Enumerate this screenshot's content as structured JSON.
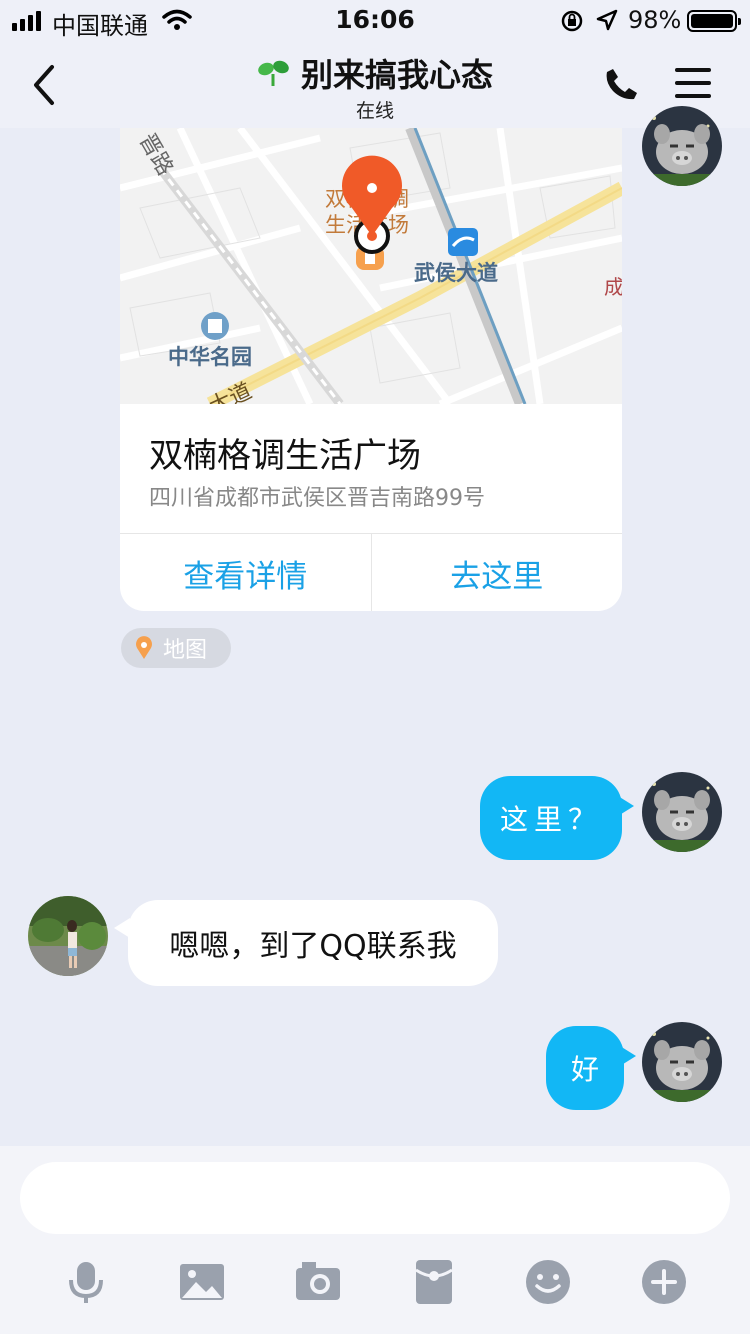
{
  "status_bar": {
    "carrier": "中国联通",
    "time": "16:06",
    "battery": "98%"
  },
  "header": {
    "title": "别来搞我心态",
    "subtitle": "在线"
  },
  "map_card": {
    "map_labels": {
      "road_1": "晋路",
      "poi_top": "双楠格调",
      "poi_bottom": "生活广场",
      "avenue": "武侯大道",
      "garden": "中华名园",
      "road_2": "大道",
      "edge_text": "成"
    },
    "place_name": "双楠格调生活广场",
    "address": "四川省成都市武侯区晋吉南路99号",
    "btn_details": "查看详情",
    "btn_go": "去这里"
  },
  "map_tag": "地图",
  "messages": [
    {
      "direction": "out",
      "text": "这里？"
    },
    {
      "direction": "in",
      "text": "嗯嗯，到了QQ联系我"
    },
    {
      "direction": "out",
      "text": "好"
    }
  ],
  "input": {
    "placeholder": ""
  },
  "toolbar_icons": [
    "mic-icon",
    "image-icon",
    "camera-icon",
    "red-packet-icon",
    "emoji-icon",
    "plus-icon"
  ],
  "colors": {
    "accent": "#12b7f5",
    "link": "#1aa1e6",
    "pin": "#f05a28",
    "background": "#e9ecf6"
  }
}
